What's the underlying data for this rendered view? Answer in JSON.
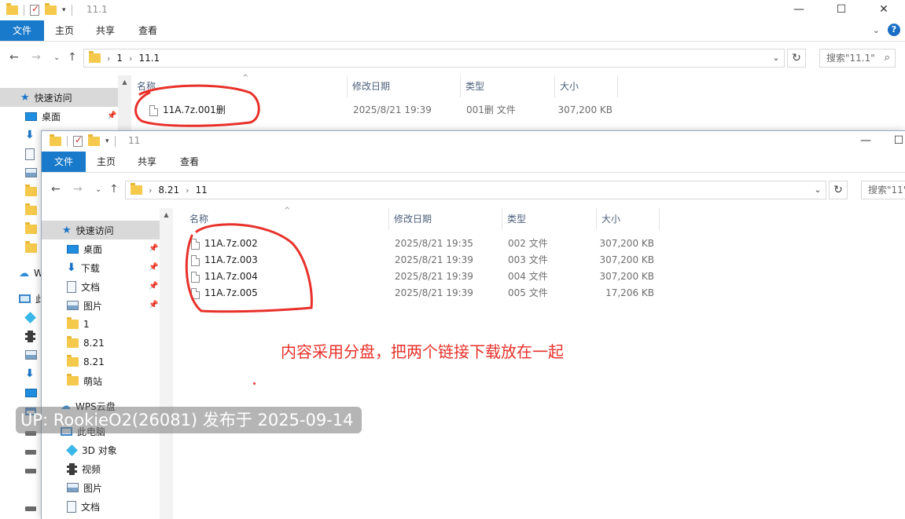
{
  "back_window": {
    "title": "11.1",
    "ribbon_tabs": [
      "文件",
      "主页",
      "共享",
      "查看"
    ],
    "breadcrumb": [
      "1",
      "11.1"
    ],
    "search_placeholder": "搜索\"11.1\"",
    "columns": [
      "名称",
      "修改日期",
      "类型",
      "大小"
    ],
    "files": [
      {
        "name": "11A.7z.001删",
        "date": "2025/8/21 19:39",
        "type": "001删 文件",
        "size": "307,200 KB"
      }
    ],
    "nav": [
      {
        "label": "快速访问",
        "icon": "star-icon"
      },
      {
        "label": "桌面",
        "icon": "desktop-icon"
      },
      {
        "label": "W",
        "icon": "cloud-icon"
      },
      {
        "label": "此",
        "icon": "computer-icon"
      }
    ]
  },
  "front_window": {
    "title": "11",
    "ribbon_tabs": [
      "文件",
      "主页",
      "共享",
      "查看"
    ],
    "breadcrumb": [
      "8.21",
      "11"
    ],
    "search_placeholder": "搜索\"11\"",
    "columns": [
      "名称",
      "修改日期",
      "类型",
      "大小"
    ],
    "files": [
      {
        "name": "11A.7z.002",
        "date": "2025/8/21 19:35",
        "type": "002 文件",
        "size": "307,200 KB"
      },
      {
        "name": "11A.7z.003",
        "date": "2025/8/21 19:39",
        "type": "003 文件",
        "size": "307,200 KB"
      },
      {
        "name": "11A.7z.004",
        "date": "2025/8/21 19:39",
        "type": "004 文件",
        "size": "307,200 KB"
      },
      {
        "name": "11A.7z.005",
        "date": "2025/8/21 19:39",
        "type": "005 文件",
        "size": "17,206 KB"
      }
    ],
    "nav": [
      {
        "label": "快速访问",
        "icon": "star-icon"
      },
      {
        "label": "桌面",
        "icon": "desktop-icon"
      },
      {
        "label": "下载",
        "icon": "download-icon"
      },
      {
        "label": "文档",
        "icon": "document-icon"
      },
      {
        "label": "图片",
        "icon": "pictures-icon"
      },
      {
        "label": "1",
        "icon": "folder-icon"
      },
      {
        "label": "8.21",
        "icon": "folder-icon"
      },
      {
        "label": "8.21",
        "icon": "folder-icon"
      },
      {
        "label": "萌站",
        "icon": "folder-icon"
      },
      {
        "label": "WPS云盘",
        "icon": "cloud-icon"
      },
      {
        "label": "此电脑",
        "icon": "computer-icon"
      },
      {
        "label": "3D 对象",
        "icon": "3d-objects-icon"
      },
      {
        "label": "视频",
        "icon": "video-icon"
      },
      {
        "label": "图片",
        "icon": "pictures-icon"
      },
      {
        "label": "文档",
        "icon": "document-icon"
      }
    ]
  },
  "annotation_text": "内容采用分盘，把两个链接下载放在一起",
  "watermark": "UP: RookieO2(26081) 发布于 2025-09-14",
  "colors": {
    "accent": "#1979ca",
    "annotation": "#e8312a",
    "folder": "#f5c94c"
  }
}
